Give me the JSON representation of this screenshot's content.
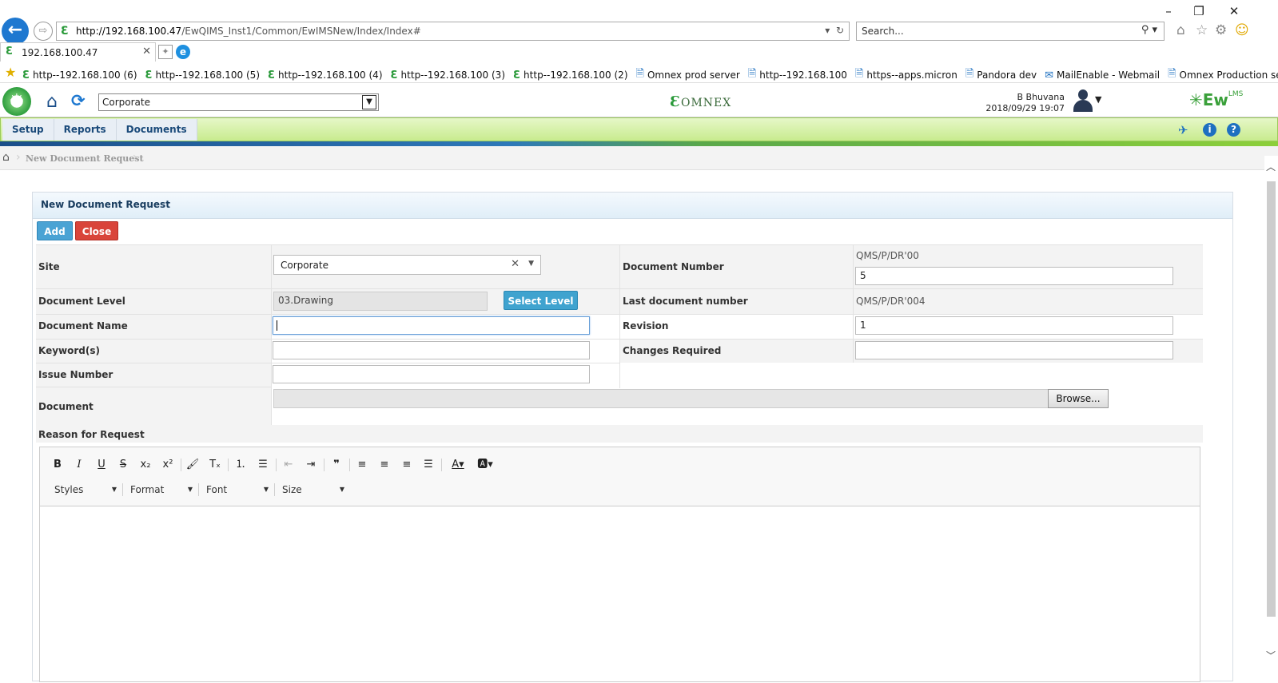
{
  "browser": {
    "window_controls": {
      "minimize": "–",
      "restore": "❐",
      "close": "✕"
    },
    "url_host": "http://192.168.100.47",
    "url_path": "/EwQIMS_Inst1/Common/EwIMSNew/Index/Index#",
    "search_placeholder": "Search...",
    "tab_title": "192.168.100.47",
    "favorites": [
      {
        "label": "http--192.168.100 (6)",
        "icon": "e"
      },
      {
        "label": "http--192.168.100 (5)",
        "icon": "e"
      },
      {
        "label": "http--192.168.100 (4)",
        "icon": "e"
      },
      {
        "label": "http--192.168.100 (3)",
        "icon": "e"
      },
      {
        "label": "http--192.168.100 (2)",
        "icon": "e"
      },
      {
        "label": "Omnex prod server",
        "icon": "doc"
      },
      {
        "label": "http--192.168.100",
        "icon": "doc"
      },
      {
        "label": "https--apps.micron",
        "icon": "doc"
      },
      {
        "label": "Pandora dev",
        "icon": "doc"
      },
      {
        "label": "MailEnable - Webmail",
        "icon": "mail"
      },
      {
        "label": "Omnex Production server",
        "icon": "doc"
      }
    ]
  },
  "app_header": {
    "site_value": "Corporate",
    "brand_center": "OMNEX",
    "user_name": "B Bhuvana",
    "timestamp": "2018/09/29 19:07",
    "brand_right": "Ew",
    "brand_right_sup": "LMS"
  },
  "menu": {
    "items": [
      "Setup",
      "Reports",
      "Documents"
    ]
  },
  "breadcrumb": {
    "current": "New Document Request"
  },
  "form": {
    "title": "New Document Request",
    "add_label": "Add",
    "close_label": "Close",
    "site_label": "Site",
    "site_value": "Corporate",
    "document_number_label": "Document Number",
    "document_number_prefix": "QMS/P/DR'00",
    "document_number_value": "5",
    "document_level_label": "Document Level",
    "document_level_value": "03.Drawing",
    "select_level_label": "Select Level",
    "last_document_number_label": "Last document number",
    "last_document_number_value": "QMS/P/DR'004",
    "document_name_label": "Document Name",
    "document_name_value": "",
    "revision_label": "Revision",
    "revision_value": "1",
    "keywords_label": "Keyword(s)",
    "keywords_value": "",
    "changes_required_label": "Changes Required",
    "changes_required_value": "",
    "issue_number_label": "Issue Number",
    "issue_number_value": "",
    "document_label": "Document",
    "browse_label": "Browse...",
    "reason_label": "Reason for Request"
  },
  "editor": {
    "styles_label": "Styles",
    "format_label": "Format",
    "font_label": "Font",
    "size_label": "Size"
  }
}
